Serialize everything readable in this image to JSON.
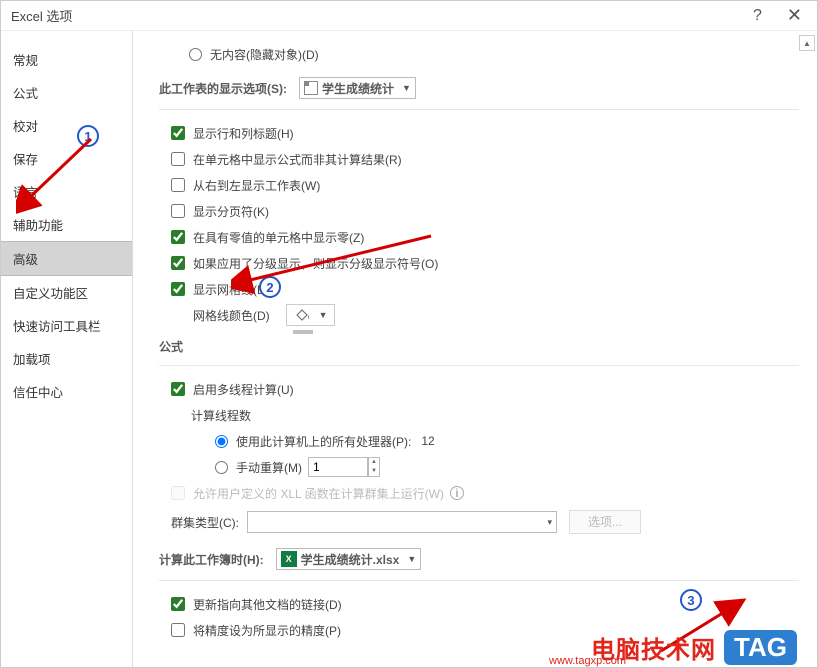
{
  "title": "Excel 选项",
  "sidebar": {
    "items": [
      {
        "label": "常规"
      },
      {
        "label": "公式"
      },
      {
        "label": "校对"
      },
      {
        "label": "保存"
      },
      {
        "label": "语言"
      },
      {
        "label": "辅助功能"
      },
      {
        "label": "高级"
      },
      {
        "label": "自定义功能区"
      },
      {
        "label": "快速访问工具栏"
      },
      {
        "label": "加载项"
      },
      {
        "label": "信任中心"
      }
    ],
    "selected": "高级"
  },
  "annotations": {
    "badge1": "1",
    "badge2": "2",
    "badge3": "3"
  },
  "content": {
    "partial_radio": "无内容(隐藏对象)(D)",
    "section_display_sheet": {
      "title": "此工作表的显示选项(S):",
      "selected_sheet": "学生成绩统计",
      "opts": {
        "show_row_col_heading": {
          "label": "显示行和列标题(H)",
          "checked": true
        },
        "show_formulas": {
          "label": "在单元格中显示公式而非其计算结果(R)",
          "checked": false
        },
        "rtl": {
          "label": "从右到左显示工作表(W)",
          "checked": false
        },
        "page_breaks": {
          "label": "显示分页符(K)",
          "checked": false
        },
        "show_zeros": {
          "label": "在具有零值的单元格中显示零(Z)",
          "checked": true
        },
        "show_outline": {
          "label": "如果应用了分级显示，则显示分级显示符号(O)",
          "checked": true
        },
        "show_gridlines": {
          "label": "显示网格线(D)",
          "checked": true
        },
        "gridline_color_label": "网格线颜色(D)"
      }
    },
    "section_formulas": {
      "title": "公式",
      "multithread": {
        "label": "启用多线程计算(U)",
        "checked": true
      },
      "threads_label": "计算线程数",
      "use_all_proc": {
        "label": "使用此计算机上的所有处理器(P):",
        "value": "12",
        "checked": true
      },
      "manual": {
        "label": "手动重算(M)",
        "value": "1",
        "checked": false
      },
      "udf_cluster": {
        "label": "允许用户定义的 XLL 函数在计算群集上运行(W)"
      },
      "cluster_type_label": "群集类型(C):",
      "options_btn": "选项..."
    },
    "section_calc_workbook": {
      "title": "计算此工作簿时(H):",
      "selected_workbook": "学生成绩统计.xlsx",
      "opts": {
        "update_links": {
          "label": "更新指向其他文档的链接(D)",
          "checked": true
        },
        "precision_as_displayed": {
          "label": "将精度设为所显示的精度(P)",
          "checked": false
        }
      }
    }
  },
  "watermark": {
    "text": "电脑技术网",
    "sub": "www.tagxp.com",
    "tag": "TAG"
  }
}
